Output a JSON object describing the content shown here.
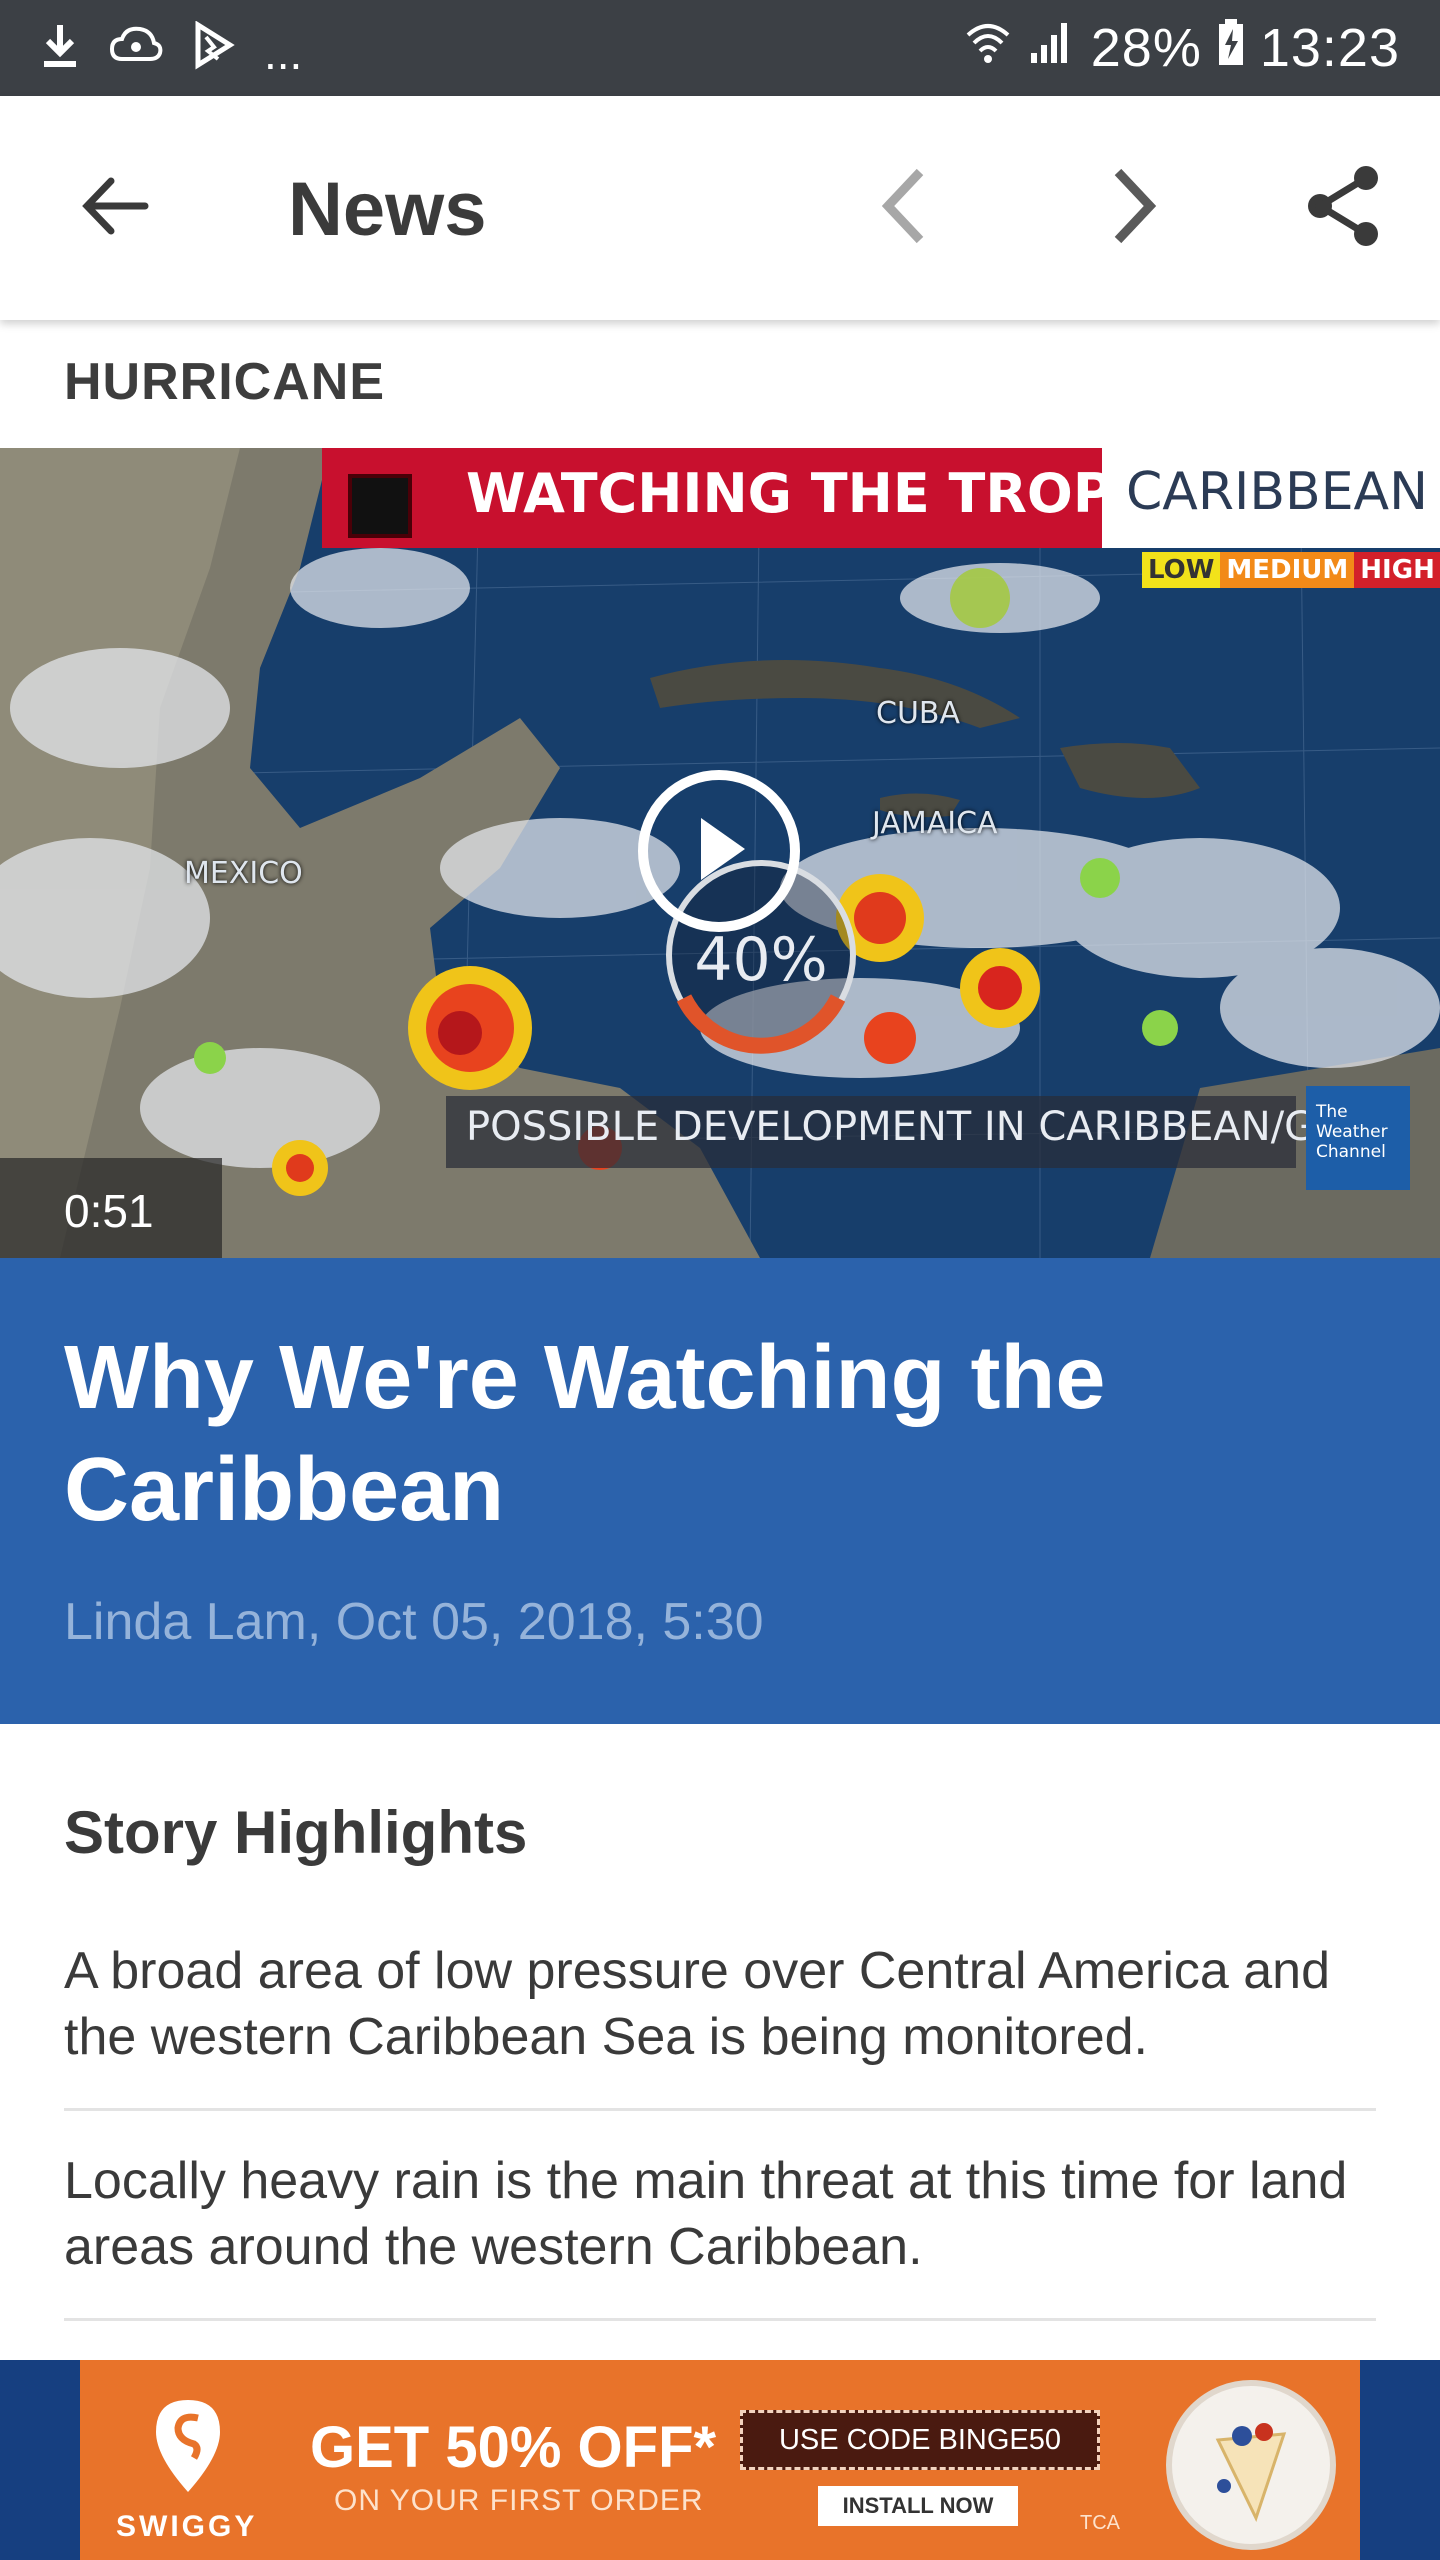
{
  "status_bar": {
    "battery": "28%",
    "time": "13:23",
    "overflow": "...",
    "icons": [
      "download-icon",
      "cloud-sync-icon",
      "bolt-flag-icon",
      "wifi-icon",
      "signal-icon",
      "battery-charging-icon"
    ]
  },
  "app_bar": {
    "title": "News",
    "icons": [
      "back-arrow-icon",
      "chevron-left-icon",
      "chevron-right-icon",
      "share-icon"
    ]
  },
  "article": {
    "category": "HURRICANE",
    "video": {
      "banner_title": "WATCHING THE TROPICS",
      "banner_region": "CARIBBEAN",
      "legend": [
        "LOW",
        "MEDIUM",
        "HIGH"
      ],
      "labels": {
        "cuba": "CUBA",
        "jamaica": "JAMAICA",
        "mexico": "MEXICO",
        "gauge": "40%"
      },
      "caption": "POSSIBLE DEVELOPMENT IN CARIBBEAN/GULF",
      "channel": "The Weather Channel",
      "duration": "0:51",
      "colors": {
        "banner_red": "#c8102e",
        "ocean": "#143a66"
      }
    },
    "headline": "Why We're Watching the Caribbean",
    "byline": "Linda Lam, Oct 05, 2018, 5:30",
    "highlights_title": "Story Highlights",
    "highlights": [
      "A broad area of low pressure over Central America and the western Caribbean Sea is being monitored.",
      "Locally heavy rain is the main threat at this time for land areas around the western Caribbean."
    ],
    "colors": {
      "headline_bg": "#2b62ac",
      "byline": "#95b3da"
    }
  },
  "ad": {
    "brand": "SWIGGY",
    "offer": "GET 50% OFF*",
    "sub": "ON YOUR FIRST ORDER",
    "code": "USE CODE BINGE50",
    "cta": "INSTALL NOW",
    "tca": "TCA",
    "colors": {
      "bg": "#e8732a",
      "frame": "#163f80"
    }
  }
}
